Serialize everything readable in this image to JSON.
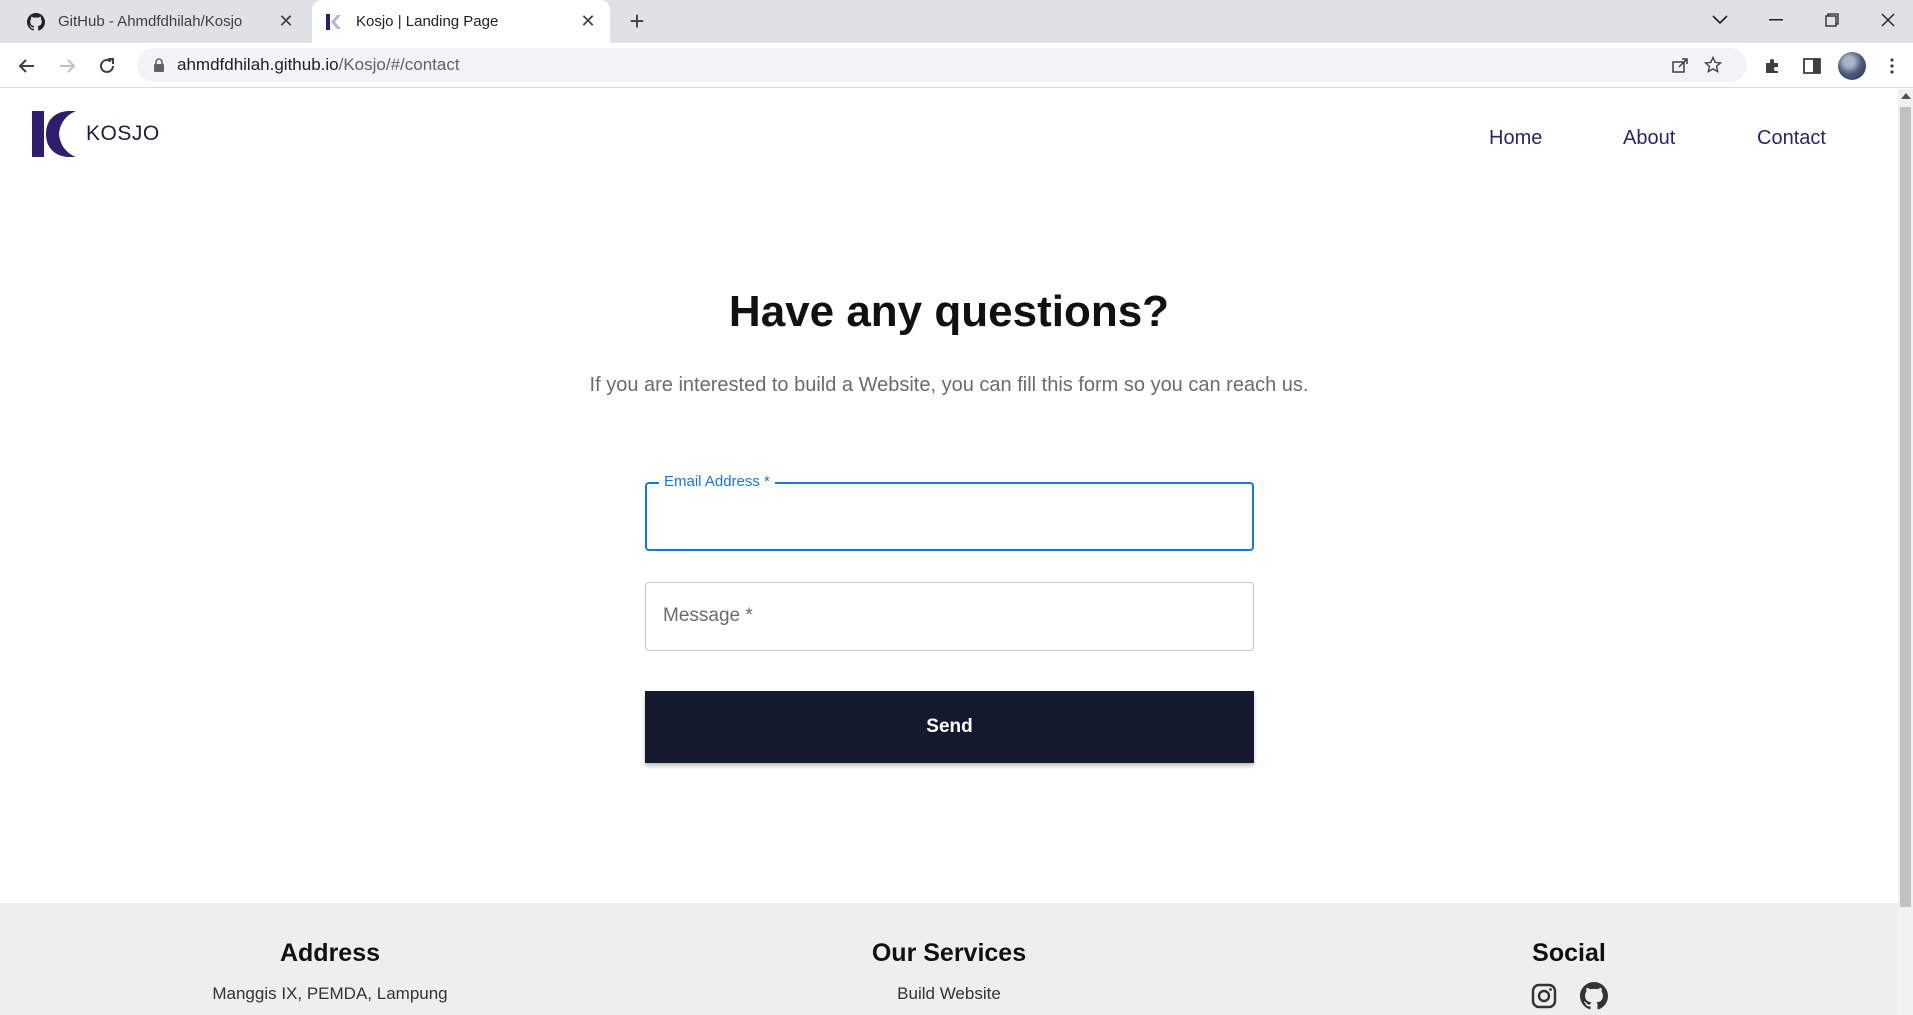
{
  "browser": {
    "tabs": [
      {
        "title": "GitHub - Ahmdfdhilah/Kosjo",
        "icon": "github-icon",
        "active": false
      },
      {
        "title": "Kosjo | Landing Page",
        "icon": "kosjo-favicon",
        "active": true
      }
    ],
    "url_host": "ahmdfdhilah.github.io",
    "url_path": "/Kosjo/#/contact"
  },
  "site": {
    "logo_text": "KOSJO",
    "brand_color": "#2d1f6e",
    "nav": [
      {
        "label": "Home"
      },
      {
        "label": "About"
      },
      {
        "label": "Contact"
      }
    ]
  },
  "contact": {
    "heading": "Have any questions?",
    "subheading": "If you are interested to build a Website, you can fill this form so you can reach us.",
    "email_label": "Email Address *",
    "email_value": "",
    "message_placeholder": "Message *",
    "send_label": "Send"
  },
  "footer": {
    "address_title": "Address",
    "address_text": "Manggis IX, PEMDA, Lampung",
    "services_title": "Our Services",
    "services_text": "Build Website",
    "social_title": "Social",
    "social_icons": [
      "instagram-icon",
      "github-icon"
    ]
  },
  "colors": {
    "focus_blue": "#1976d2",
    "button_dark": "#141a2e",
    "nav_text": "#2d2466"
  }
}
